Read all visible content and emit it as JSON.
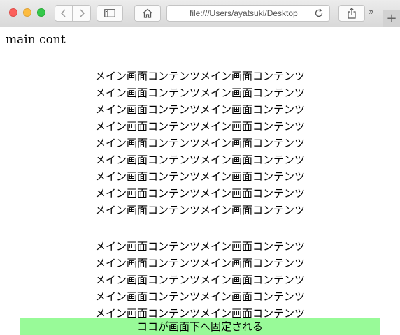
{
  "browser": {
    "address": "file:///Users/ayatsuki/Desktop",
    "more_tabs_label": "»",
    "new_tab_label": "+"
  },
  "page": {
    "heading": "main cont",
    "content_line": "メイン画面コンテンツメイン画面コンテンツ",
    "block1_lines": 9,
    "block2_lines": 5,
    "fixed_footer": "ココが画面下へ固定される"
  },
  "colors": {
    "footer_bg": "#98fa98"
  }
}
